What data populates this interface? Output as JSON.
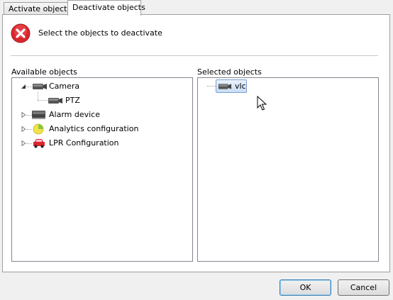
{
  "tabs": [
    {
      "label": "Activate objects"
    },
    {
      "label": "Deactivate objects"
    }
  ],
  "header": {
    "text": "Select the objects to deactivate",
    "icon": "error-x-icon"
  },
  "available": {
    "label": "Available objects",
    "items": [
      {
        "label": "Camera",
        "icon": "camera-icon",
        "children": [
          {
            "label": "PTZ",
            "icon": "camera-icon"
          }
        ]
      },
      {
        "label": "Alarm device",
        "icon": "alarm-device-icon"
      },
      {
        "label": "Analytics configuration",
        "icon": "pie-chart-icon"
      },
      {
        "label": "LPR Configuration",
        "icon": "car-icon"
      }
    ]
  },
  "selected": {
    "label": "Selected objects",
    "items": [
      {
        "label": "vlc",
        "icon": "camera-icon"
      }
    ]
  },
  "buttons": {
    "ok": "OK",
    "cancel": "Cancel"
  },
  "colors": {
    "error_red": "#d9262c",
    "selection_border": "#7da2ce",
    "default_button_border": "#3c7fb1"
  }
}
